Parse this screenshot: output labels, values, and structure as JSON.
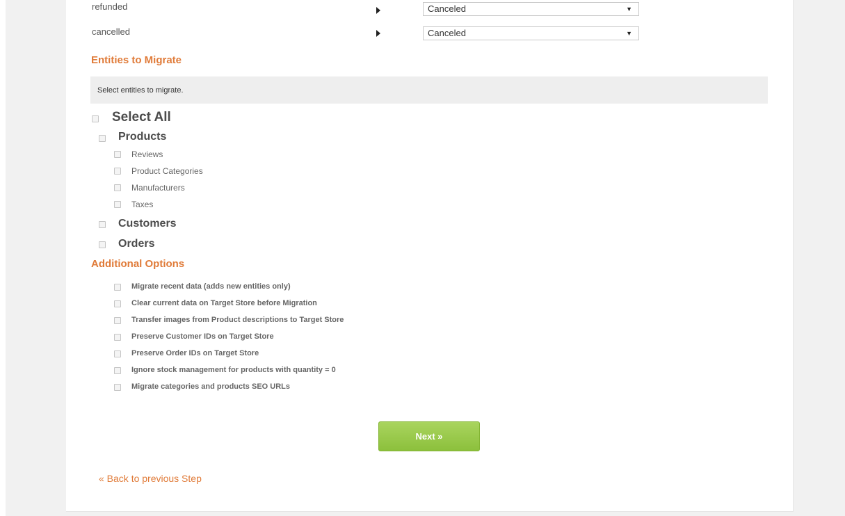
{
  "order_status_rows": [
    {
      "source": "refunded",
      "target": "Canceled"
    },
    {
      "source": "cancelled",
      "target": "Canceled"
    }
  ],
  "entities": {
    "title": "Entities to Migrate",
    "hint": "Select entities to migrate.",
    "select_all": "Select All",
    "products": "Products",
    "product_children": [
      "Reviews",
      "Product Categories",
      "Manufacturers",
      "Taxes"
    ],
    "customers": "Customers",
    "orders": "Orders"
  },
  "additional": {
    "title": "Additional Options",
    "options": [
      "Migrate recent data (adds new entities only)",
      "Clear current data on Target Store before Migration",
      "Transfer images from Product descriptions to Target Store",
      "Preserve Customer IDs on Target Store",
      "Preserve Order IDs on Target Store",
      "Ignore stock management for products with quantity = 0",
      "Migrate categories and products SEO URLs"
    ]
  },
  "next_label": "Next »",
  "back_label": "« Back to previous Step",
  "colors": {
    "accent": "#e07b39",
    "button_green": "#98c84a"
  }
}
